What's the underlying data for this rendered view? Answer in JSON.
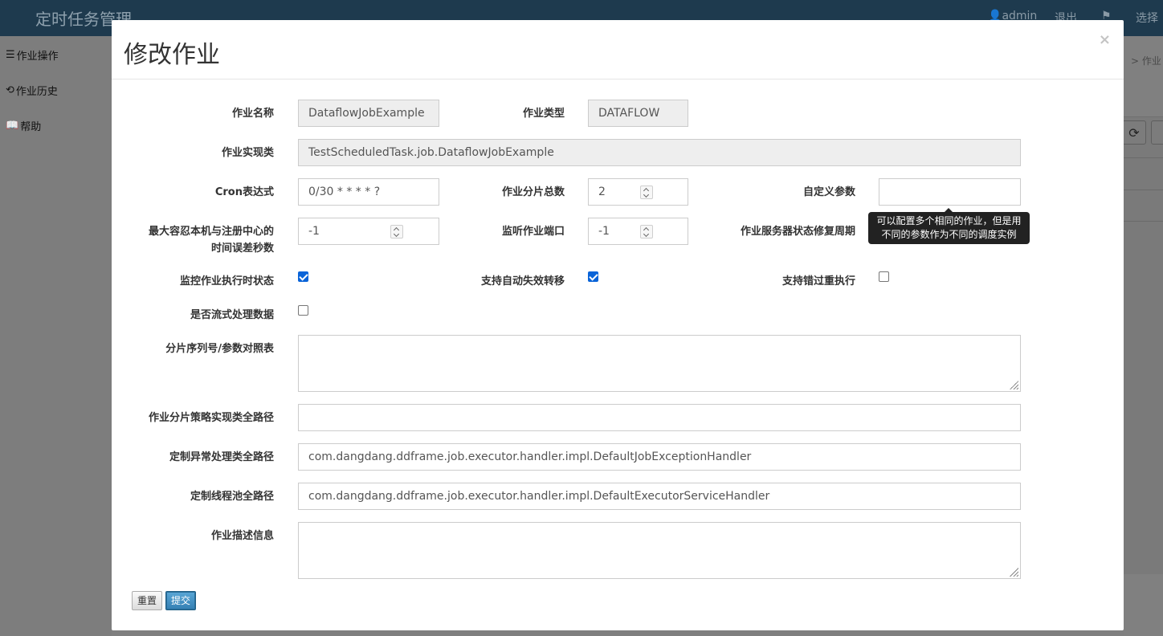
{
  "app": {
    "brand": "定时任务管理",
    "user": "admin",
    "logout": "退出",
    "choose": "选择",
    "breadcrumb_fragment": "作业"
  },
  "sidebar": {
    "items": [
      {
        "label": "作业操作",
        "icon": "list-icon"
      },
      {
        "label": "作业历史",
        "icon": "history-icon"
      },
      {
        "label": "帮助",
        "icon": "book-icon"
      }
    ]
  },
  "modal": {
    "title": "修改作业",
    "close": "×"
  },
  "form": {
    "job_name": {
      "label": "作业名称",
      "value": "DataflowJobExample"
    },
    "job_type": {
      "label": "作业类型",
      "value": "DATAFLOW"
    },
    "job_class": {
      "label": "作业实现类",
      "value": "TestScheduledTask.job.DataflowJobExample"
    },
    "cron": {
      "label": "Cron表达式",
      "value": "0/30 * * * * ?"
    },
    "sharding_total": {
      "label": "作业分片总数",
      "value": "2"
    },
    "job_parameter": {
      "label": "自定义参数",
      "value": ""
    },
    "max_time_diff": {
      "label_line1": "最大容忍本机与注册中心的",
      "label_line2": "时间误差秒数",
      "value": "-1"
    },
    "monitor_port": {
      "label": "监听作业端口",
      "value": "-1"
    },
    "reconcile_interval": {
      "label": "作业服务器状态修复周期"
    },
    "monitor_execution": {
      "label": "监控作业执行时状态",
      "checked": true
    },
    "failover": {
      "label": "支持自动失效转移",
      "checked": true
    },
    "misfire": {
      "label": "支持错过重执行",
      "checked": false
    },
    "streaming_process": {
      "label": "是否流式处理数据",
      "checked": false
    },
    "sharding_params": {
      "label": "分片序列号/参数对照表",
      "value": ""
    },
    "sharding_strategy": {
      "label": "作业分片策略实现类全路径",
      "value": ""
    },
    "exception_handler": {
      "label": "定制异常处理类全路径",
      "value": "com.dangdang.ddframe.job.executor.handler.impl.DefaultJobExceptionHandler"
    },
    "executor_handler": {
      "label": "定制线程池全路径",
      "value": "com.dangdang.ddframe.job.executor.handler.impl.DefaultExecutorServiceHandler"
    },
    "description": {
      "label": "作业描述信息",
      "value": ""
    }
  },
  "tooltip": {
    "line1": "可以配置多个相同的作业，但是用",
    "line2": "不同的参数作为不同的调度实例"
  },
  "buttons": {
    "reset": "重置",
    "submit": "提交"
  }
}
